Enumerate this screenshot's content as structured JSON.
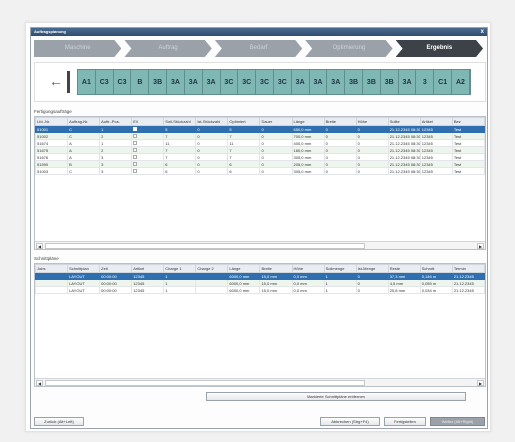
{
  "window": {
    "title": "Auftragsplanung",
    "close": "x"
  },
  "wizard": {
    "steps": [
      "Maschine",
      "Auftrag",
      "Bedarf",
      "Optimierung",
      "Ergebnis"
    ],
    "active_index": 4
  },
  "diagram": {
    "segments": [
      "A1",
      "C3",
      "C3",
      "B",
      "3B",
      "3A",
      "3A",
      "3A",
      "3C",
      "3C",
      "3C",
      "3C",
      "3A",
      "3A",
      "3A",
      "3B",
      "3B",
      "3B",
      "3A",
      "3",
      "C1",
      "A2"
    ]
  },
  "orders": {
    "label": "Fertigungsaufträge",
    "columns": [
      "Lfd.-Nr.",
      "Auftrag-Nr.",
      "Auftr.-Pos.",
      "Eil",
      "Soll-Stückzahl",
      "Ist-Stückzahl",
      "Optimiert",
      "Dauer",
      "Länge",
      "Breite",
      "Höhe",
      "Sollte",
      "Artikel",
      "Bez"
    ],
    "rows": [
      [
        "51001",
        "C",
        "1",
        "",
        "5",
        "0",
        "5",
        "0",
        "650,0 mm",
        "0",
        "0",
        "21.12.2345 08:30:00",
        "12345",
        "Test"
      ],
      [
        "51002",
        "C",
        "2",
        "",
        "7",
        "0",
        "7",
        "0",
        "700,0 mm",
        "0",
        "0",
        "21.12.2345 08:30:00",
        "12345",
        "Test"
      ],
      [
        "51674",
        "A",
        "1",
        "",
        "11",
        "0",
        "11",
        "0",
        "400,0 mm",
        "0",
        "0",
        "21.12.2345 08:30:00",
        "12345",
        "Test"
      ],
      [
        "51675",
        "A",
        "2",
        "",
        "7",
        "0",
        "7",
        "0",
        "180,0 mm",
        "0",
        "0",
        "21.12.2345 08:30:00",
        "12345",
        "Test"
      ],
      [
        "51676",
        "A",
        "3",
        "",
        "7",
        "0",
        "7",
        "0",
        "305,0 mm",
        "0",
        "0",
        "21.12.2345 08:30:00",
        "12345",
        "Test"
      ],
      [
        "51590",
        "B",
        "3",
        "",
        "6",
        "0",
        "6",
        "0",
        "205,0 mm",
        "0",
        "0",
        "21.12.2345 08:30:00",
        "12345",
        "Test"
      ],
      [
        "51003",
        "C",
        "3",
        "",
        "6",
        "0",
        "6",
        "0",
        "305,0 mm",
        "0",
        "0",
        "21.12.2345 08:30:00",
        "12345",
        "Test"
      ]
    ]
  },
  "plans": {
    "label": "Schnittpläne",
    "columns": [
      "Jobs",
      "Schnittplan",
      "Zeit",
      "Artikel",
      "Charge 1",
      "Charge 2",
      "Länge",
      "Breite",
      "Höhe",
      "Sollmenge",
      "Ist-Menge",
      "Reste",
      "Schrott",
      "Termin"
    ],
    "rows": [
      [
        "",
        "LAYOUT",
        "00:00:00",
        "12345",
        "1",
        "",
        "6000,0 mm",
        "15,0 mm",
        "0,0 mm",
        "1",
        "0",
        "37,3 mm",
        "0,146 m",
        "21.12.2345"
      ],
      [
        "",
        "LAYOUT",
        "00:00:00",
        "12345",
        "1",
        "",
        "6000,0 mm",
        "15,0 mm",
        "0,0 mm",
        "1",
        "0",
        "4,5 mm",
        "0,055 m",
        "21.12.2345"
      ],
      [
        "",
        "LAYOUT",
        "00:00:00",
        "12345",
        "1",
        "",
        "6000,0 mm",
        "15,0 mm",
        "0,0 mm",
        "1",
        "0",
        "25,8 mm",
        "0,034 m",
        "21.12.2345"
      ]
    ],
    "remove_button": "Markierte Schnittpläne entfernen"
  },
  "footer": {
    "back": "Zurück (Alt+Left)",
    "cancel": "Abbrechen (Strg+F4)",
    "finish": "Fertigstellen",
    "next": "Weiter (Alt+Right)"
  },
  "colors": {
    "accent": "#2f6fb0",
    "diagram": "#7fb7b4"
  }
}
